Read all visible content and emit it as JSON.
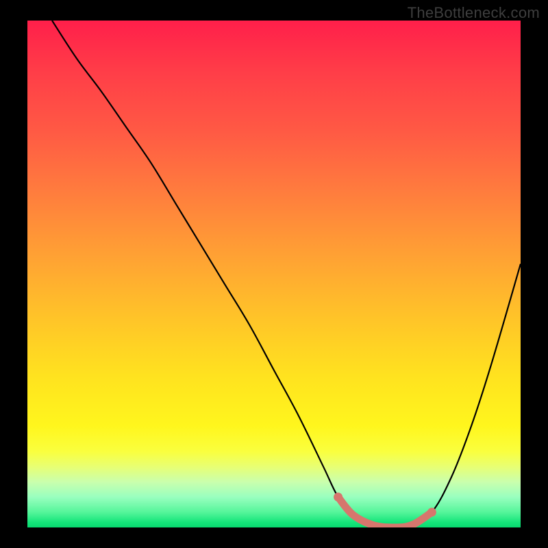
{
  "watermark": "TheBottleneck.com",
  "chart_data": {
    "type": "line",
    "title": "",
    "xlabel": "",
    "ylabel": "",
    "xlim": [
      0,
      100
    ],
    "ylim": [
      0,
      100
    ],
    "grid": false,
    "series": [
      {
        "name": "bottleneck-curve",
        "x": [
          5,
          10,
          15,
          20,
          25,
          30,
          35,
          40,
          45,
          50,
          55,
          60,
          63,
          66,
          70,
          74,
          78,
          82,
          86,
          90,
          94,
          100
        ],
        "y": [
          100,
          92.5,
          86,
          79,
          72,
          64,
          56,
          48,
          40,
          31,
          22,
          12,
          6,
          2.5,
          0.5,
          0,
          0.5,
          3,
          10,
          20,
          32,
          52
        ]
      }
    ],
    "highlight": {
      "name": "optimal-band",
      "x": [
        63,
        66,
        70,
        74,
        78,
        82
      ],
      "y": [
        6,
        2.5,
        0.5,
        0,
        0.5,
        3
      ]
    },
    "endpoints": [
      {
        "x": 63,
        "y": 6
      },
      {
        "x": 82,
        "y": 3
      }
    ],
    "gradient_meaning": "vertical heat gradient (red=high bottleneck at top, green=low at bottom)"
  }
}
